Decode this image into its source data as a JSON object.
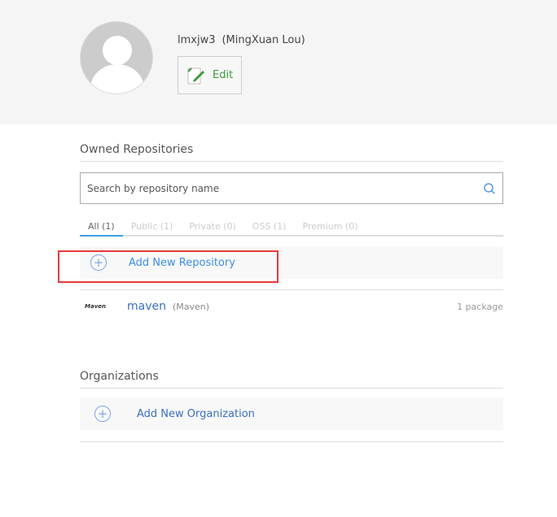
{
  "profile": {
    "username": "lmxjw3",
    "full_name": "(MingXuan Lou)",
    "edit_label": "Edit"
  },
  "owned": {
    "title": "Owned Repositories",
    "search_placeholder": "Search by repository name",
    "tabs": [
      {
        "label": "All (1)"
      },
      {
        "label": "Public (1)"
      },
      {
        "label": "Private (0)"
      },
      {
        "label": "OSS (1)"
      },
      {
        "label": "Premium (0)"
      }
    ],
    "add_label": "Add New Repository",
    "repos": [
      {
        "logo": "Maven",
        "name": "maven",
        "type": "(Maven)",
        "count": "1 package"
      }
    ]
  },
  "orgs": {
    "title": "Organizations",
    "add_label": "Add New Organization"
  }
}
